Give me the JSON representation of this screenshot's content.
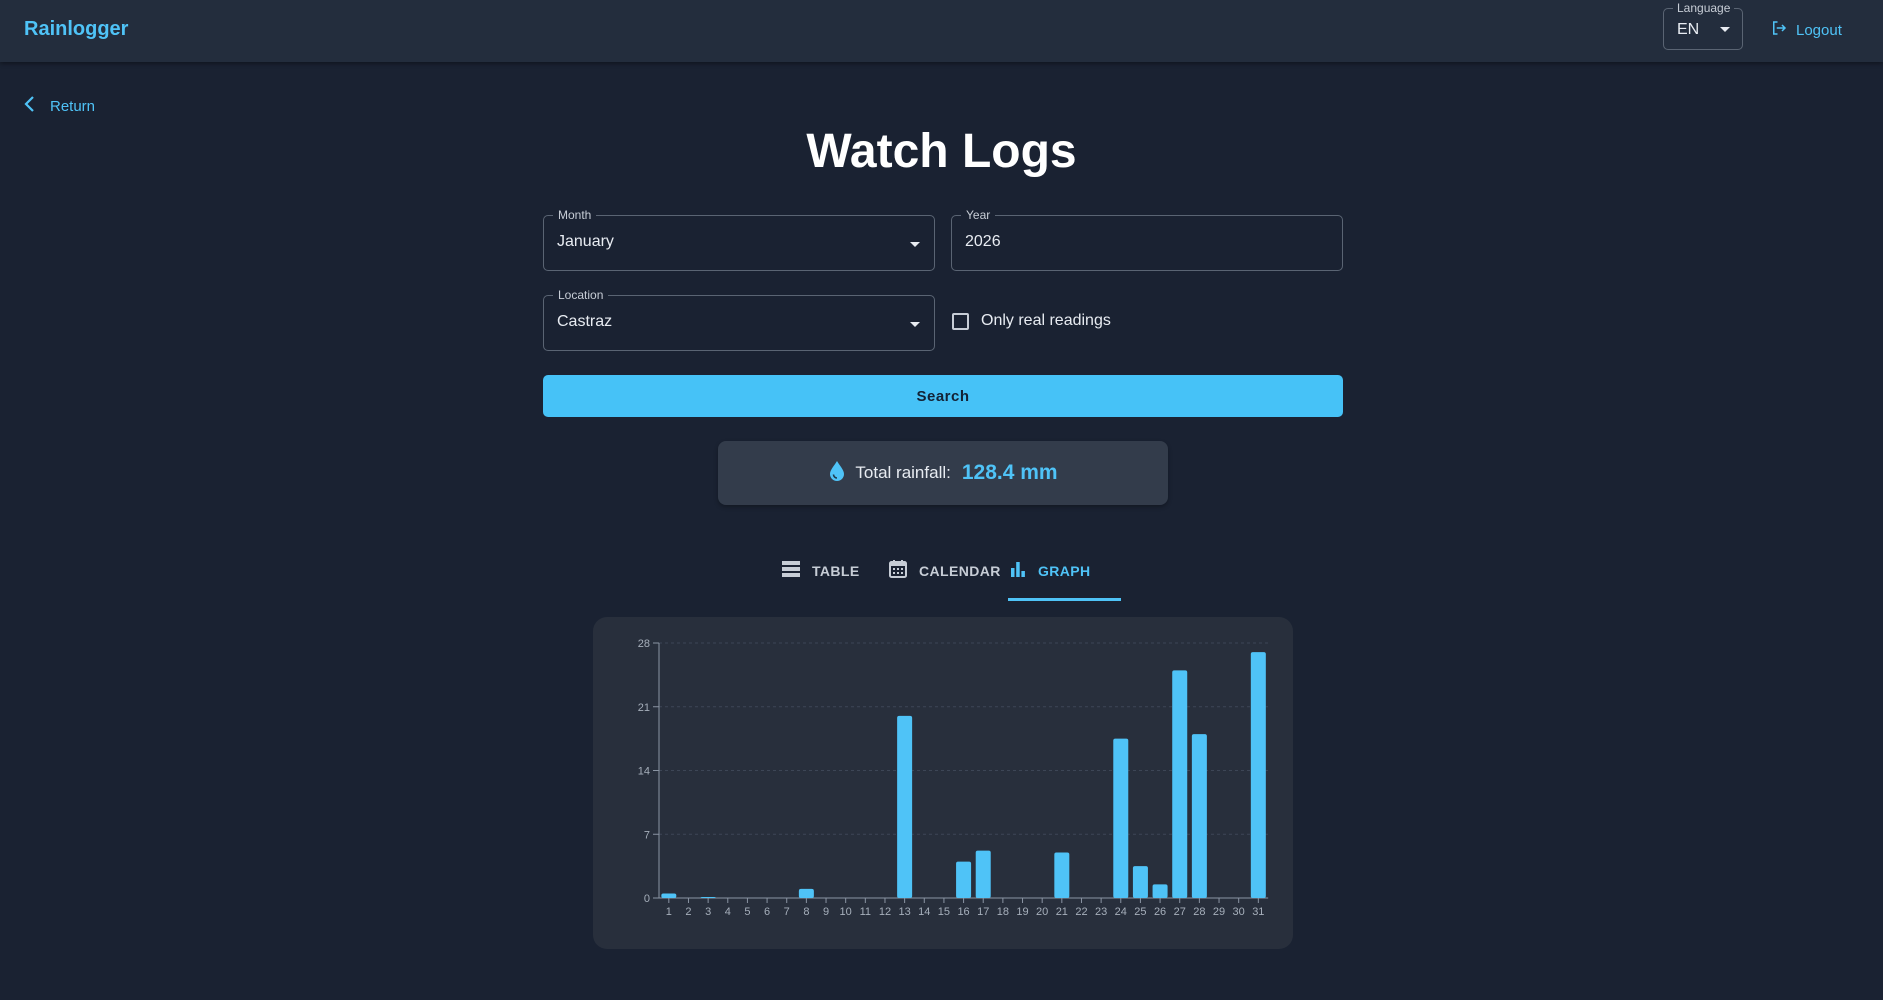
{
  "app": {
    "brand": "Rainlogger"
  },
  "header": {
    "language_label": "Language",
    "language_value": "EN",
    "logout_label": "Logout"
  },
  "nav": {
    "return_label": "Return"
  },
  "page": {
    "title": "Watch Logs"
  },
  "filters": {
    "month": {
      "label": "Month",
      "value": "January"
    },
    "year": {
      "label": "Year",
      "value": "2026"
    },
    "location": {
      "label": "Location",
      "value": "Castraz"
    },
    "only_real": {
      "label": "Only real readings",
      "checked": false
    },
    "search_label": "Search"
  },
  "summary": {
    "label": "Total rainfall:",
    "value": "128.4 mm"
  },
  "tabs": [
    {
      "label": "TABLE",
      "icon": "table-icon",
      "active": false
    },
    {
      "label": "CALENDAR",
      "icon": "calendar-icon",
      "active": false
    },
    {
      "label": "GRAPH",
      "icon": "bar-chart-icon",
      "active": true
    }
  ],
  "colors": {
    "accent": "#4fc3f7",
    "background": "#1a2232",
    "bar": "#4fc3f7"
  },
  "chart_data": {
    "type": "bar",
    "categories": [
      "1",
      "2",
      "3",
      "4",
      "5",
      "6",
      "7",
      "8",
      "9",
      "10",
      "11",
      "12",
      "13",
      "14",
      "15",
      "16",
      "17",
      "18",
      "19",
      "20",
      "21",
      "22",
      "23",
      "24",
      "25",
      "26",
      "27",
      "28",
      "29",
      "30",
      "31"
    ],
    "values": [
      0.5,
      0,
      0.1,
      0,
      0,
      0,
      0,
      1,
      0,
      0,
      0,
      0,
      20,
      0,
      0,
      4,
      5.2,
      0,
      0,
      0,
      5,
      0,
      0,
      17.5,
      3.5,
      1.5,
      25,
      18,
      0,
      0,
      27
    ],
    "ylim": [
      0,
      28
    ],
    "yticks": [
      0,
      7,
      14,
      21,
      28
    ],
    "grid": true,
    "legend": "none"
  }
}
